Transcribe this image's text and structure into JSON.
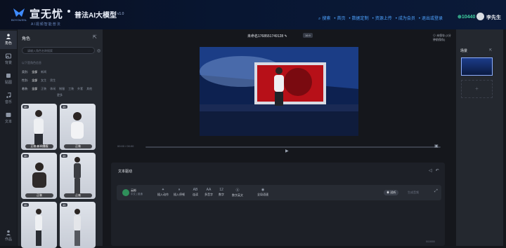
{
  "colors": {
    "accent": "#2c7bff",
    "header_bg": "#081632",
    "coins": "#3fd0a0",
    "nav_link": "#4ea3ff"
  },
  "header": {
    "logo_caption": "BOYOUSSL",
    "brand": "宣无忧",
    "product": "普法AI大模型",
    "version": "v1.0",
    "tagline": "AI视频智能普法",
    "nav": [
      "搜索",
      "首页",
      "数据定制",
      "资源上传",
      "成为会员",
      "退出或登录"
    ],
    "coins": "10440",
    "user": "李先生"
  },
  "rail": [
    {
      "label": "角色",
      "icon": "person-icon"
    },
    {
      "label": "背景",
      "icon": "background-icon"
    },
    {
      "label": "贴图",
      "icon": "sticker-icon"
    },
    {
      "label": "音乐",
      "icon": "music-icon"
    },
    {
      "label": "文本",
      "icon": "text-icon"
    },
    {
      "label": "作品",
      "icon": "works-icon"
    }
  ],
  "left_panel": {
    "title": "角色",
    "search_placeholder": "请输入角色名称搜索",
    "hint": "以下是角色信息",
    "filters": [
      {
        "label": "类别:",
        "options": [
          "全部",
          "新闻"
        ]
      },
      {
        "label": "性别:",
        "options": [
          "全部",
          "女生",
          "男生"
        ]
      },
      {
        "label": "着装:",
        "options": [
          "全部",
          "正装",
          "休闲",
          "制服",
          "工装",
          "外套",
          "其他"
        ]
      }
    ],
    "more": "更多",
    "cards": [
      {
        "badge": "4K",
        "caption": "正装-新闻播报"
      },
      {
        "badge": "4K",
        "caption": "正装"
      },
      {
        "badge": "4K",
        "caption": "正装"
      },
      {
        "badge": "4K",
        "caption": "正装"
      },
      {
        "badge": "4K",
        "caption": ""
      },
      {
        "badge": "4K",
        "caption": ""
      }
    ]
  },
  "center": {
    "doc_title": "未命名1768551749128",
    "ratio": "16:9",
    "saved": "未保存 (1分钟前保存)",
    "generate": "生成视频",
    "time": "00:00 / 00:00",
    "text_panel_title": "文本驱动",
    "voice_name": "云彬",
    "voice_sub": "中文 | 普通",
    "tools": [
      {
        "label": "插入动作",
        "icon": "action-icon"
      },
      {
        "label": "插入停顿",
        "icon": "pause-icon"
      },
      {
        "label": "连读",
        "icon": "link-icon"
      },
      {
        "label": "多音字",
        "icon": "polyphone-icon"
      },
      {
        "label": "数字",
        "icon": "number-icon"
      },
      {
        "label": "数字英文",
        "icon": "numeric-english-icon"
      },
      {
        "label": "全局语速",
        "icon": "speed-icon"
      }
    ],
    "trial": "试听",
    "gen_audio": "生成音频",
    "char_count": "0/10000"
  },
  "right_panel": {
    "title": "场景",
    "add": "+"
  }
}
